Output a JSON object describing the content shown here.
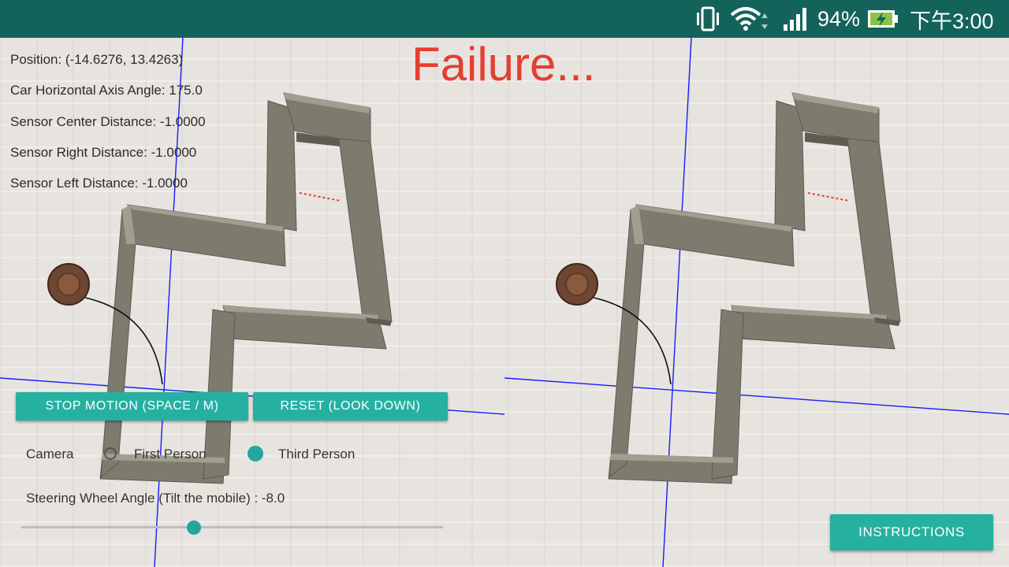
{
  "status_bar": {
    "battery": "94%",
    "time": "下午3:00",
    "icons": [
      "vibrate-icon",
      "wifi-icon",
      "signal-icon",
      "battery-charging-icon"
    ]
  },
  "hud": {
    "position": "Position: (-14.6276, 13.4263)",
    "angle": "Car Horizontal Axis Angle: 175.0",
    "sensor_center": "Sensor Center Distance: -1.0000",
    "sensor_right": "Sensor Right Distance: -1.0000",
    "sensor_left": "Sensor Left Distance: -1.0000"
  },
  "status_title": "Failure...",
  "buttons": {
    "stop": "STOP MOTION (SPACE / M)",
    "reset": "RESET (LOOK DOWN)",
    "instructions": "INSTRUCTIONS"
  },
  "camera": {
    "label": "Camera",
    "options": [
      "First Person",
      "Third Person"
    ],
    "selected": "Third Person"
  },
  "steering": {
    "label": "Steering Wheel Angle (Tilt the mobile) : -8.0",
    "slider_fraction": 0.41
  },
  "colors": {
    "status_bar": "#14635b",
    "accent": "#26b0a1",
    "failure": "#e53e30",
    "axis": "#1a1aff"
  }
}
